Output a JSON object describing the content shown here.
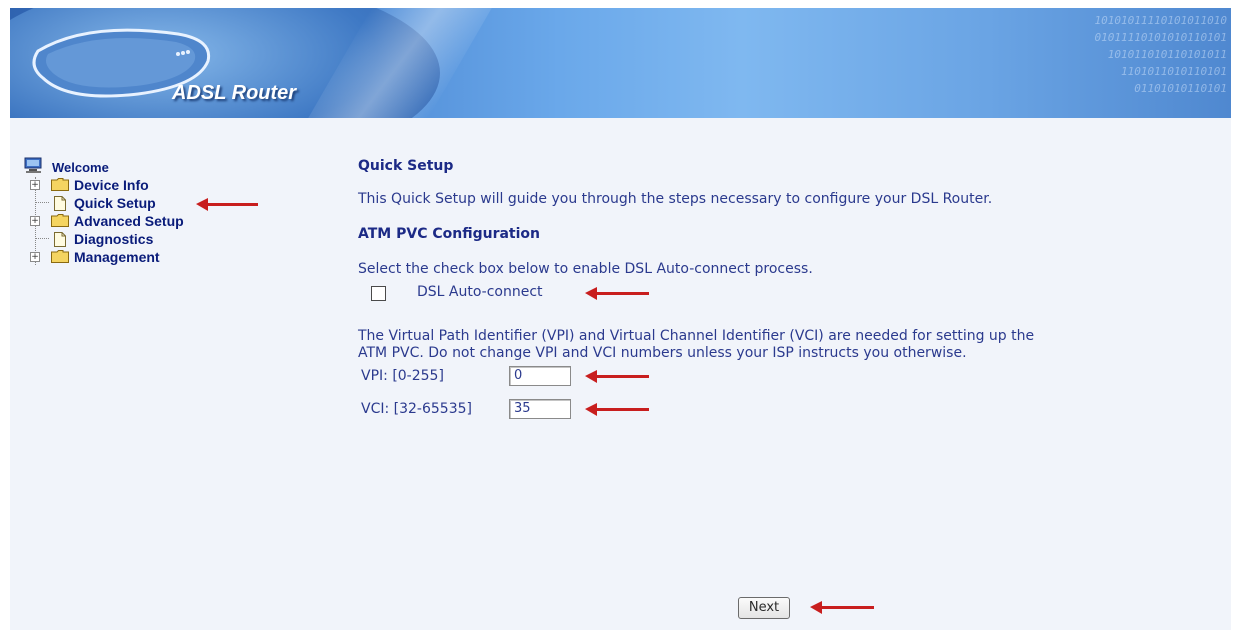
{
  "header": {
    "logo_text": "ADSL Router",
    "binary_pattern": "10101011110101011010\n  01011110101010110101\n    101011010110101011\n      1101011010110101\n        01101010110101"
  },
  "sidebar": {
    "items": [
      {
        "label": "Welcome",
        "icon": "computer-icon"
      },
      {
        "label": "Device Info",
        "icon": "folder-icon"
      },
      {
        "label": "Quick Setup",
        "icon": "document-icon"
      },
      {
        "label": "Advanced Setup",
        "icon": "folder-icon"
      },
      {
        "label": "Diagnostics",
        "icon": "document-icon"
      },
      {
        "label": "Management",
        "icon": "folder-icon"
      }
    ]
  },
  "main": {
    "title": "Quick Setup",
    "intro": "This Quick Setup will guide you through the steps necessary to configure your DSL Router.",
    "section_title": "ATM PVC Configuration",
    "auto_connect_instruction": "Select the check box below to enable DSL Auto-connect process.",
    "auto_connect_label": "DSL Auto-connect",
    "auto_connect_checked": false,
    "vpi_vci_info_line1": "The Virtual Path Identifier (VPI) and Virtual Channel Identifier (VCI) are needed for setting up the",
    "vpi_vci_info_line2": "ATM PVC. Do not change VPI and VCI numbers unless your ISP instructs you otherwise.",
    "vpi_label": "VPI: [0-255]",
    "vpi_value": "0",
    "vci_label": "VCI: [32-65535]",
    "vci_value": "35",
    "next_label": "Next"
  },
  "colors": {
    "link_text": "#0a1c7a",
    "annotation_arrow": "#c81e1e"
  }
}
